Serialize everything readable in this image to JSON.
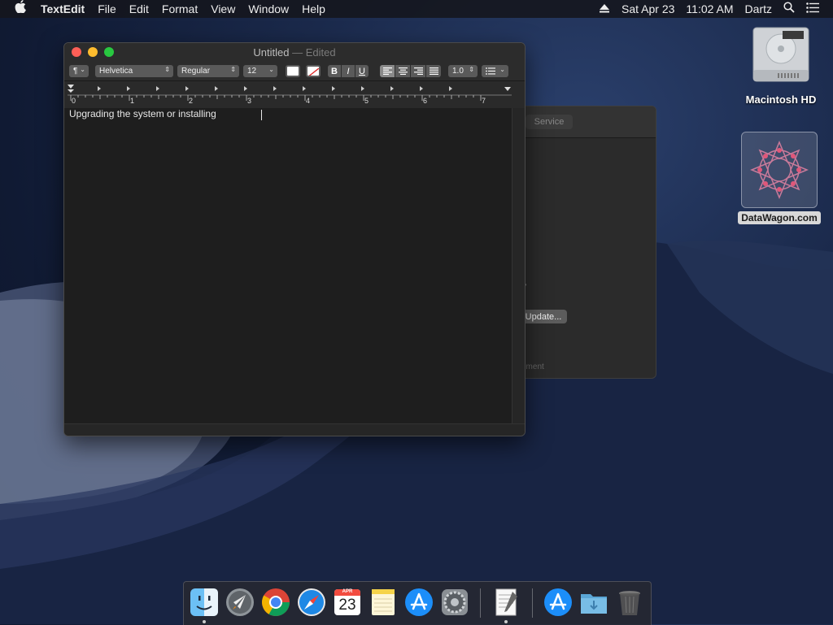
{
  "menubar": {
    "app_name": "TextEdit",
    "menus": [
      "File",
      "Edit",
      "Format",
      "View",
      "Window",
      "Help"
    ],
    "date": "Sat Apr 23",
    "time": "11:02 AM",
    "user": "Dartz"
  },
  "textedit": {
    "title": "Untitled",
    "title_sep": "—",
    "title_state": "Edited",
    "toolbar": {
      "paragraph": "¶",
      "font": "Helvetica",
      "style": "Regular",
      "size": "12",
      "bold": "B",
      "italic": "I",
      "underline": "U",
      "spacing": "1.0"
    },
    "ruler_labels": [
      "0",
      "1",
      "2",
      "3",
      "4",
      "5",
      "6",
      "7"
    ],
    "content": "Upgrading the system or installing"
  },
  "background_window": {
    "service_button": "Service",
    "update_button": "Update...",
    "partial_text": "v",
    "footer_text": "ement"
  },
  "desktop": {
    "hd_label": "Macintosh HD",
    "datawagon_label": "DataWagon.com"
  },
  "dock": {
    "items": [
      "finder-icon",
      "launchpad-icon",
      "chrome-icon",
      "safari-icon",
      "calendar-icon",
      "notes-icon",
      "app-store-icon",
      "system-preferences-icon",
      "textedit-icon",
      "app-store-download-icon",
      "downloads-folder-icon",
      "trash-icon"
    ],
    "calendar_month": "APR",
    "calendar_day": "23"
  },
  "colors": {
    "close": "#fe5f57",
    "minimize": "#febc2e",
    "zoom": "#28c840"
  }
}
